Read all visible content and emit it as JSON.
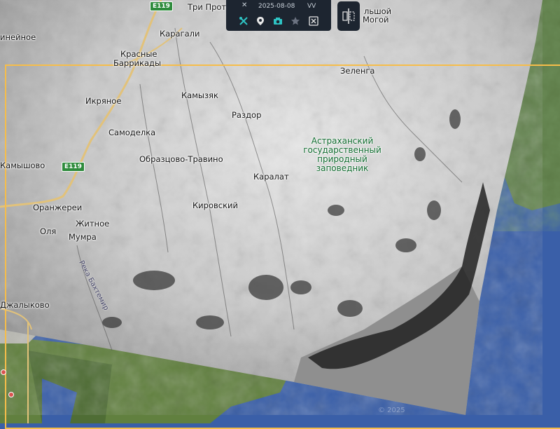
{
  "toolbar": {
    "close_symbol": "✕",
    "date": "2025-08-08",
    "polarization": "VV",
    "icons": [
      "tools-icon",
      "location-icon",
      "camera-icon",
      "star-icon",
      "scissors-icon"
    ]
  },
  "colors": {
    "frame": "#f6bd4a",
    "toolbar_bg": "#1d2530",
    "icon_teal": "#2ec4c4",
    "water": "#3a5fa8",
    "reserve_label": "#0f6b2e"
  },
  "places": {
    "tri_protoka": "Три Прот",
    "bolshoy_mogoy_1": "льшой",
    "bolshoy_mogoy_2": "Могой",
    "karagali": "Карагали",
    "krasnye_1": "Красные",
    "krasnye_2": "Баррикады",
    "zelenga": "Зеленга",
    "kamyzyak": "Камызяк",
    "razdor": "Раздор",
    "ikryanoe": "Икряное",
    "samosdelka": "Самоделка",
    "obraztsovo": "Образцово-Травино",
    "karalat": "Каралат",
    "kamyshovo": "Камышово",
    "oranzherei": "Оранжереи",
    "kirovskiy": "Кировский",
    "zhitnoe": "Житное",
    "olya": "Оля",
    "mumra": "Мумра",
    "dzhalykovo": "Джалыково",
    "lineynoe": "инейное",
    "river": "Река Бахтемир"
  },
  "reserve_lines": [
    "Астраханский",
    "государственный",
    "природный",
    "заповедник"
  ],
  "road_shield": "E119",
  "watermark": "© 2025"
}
